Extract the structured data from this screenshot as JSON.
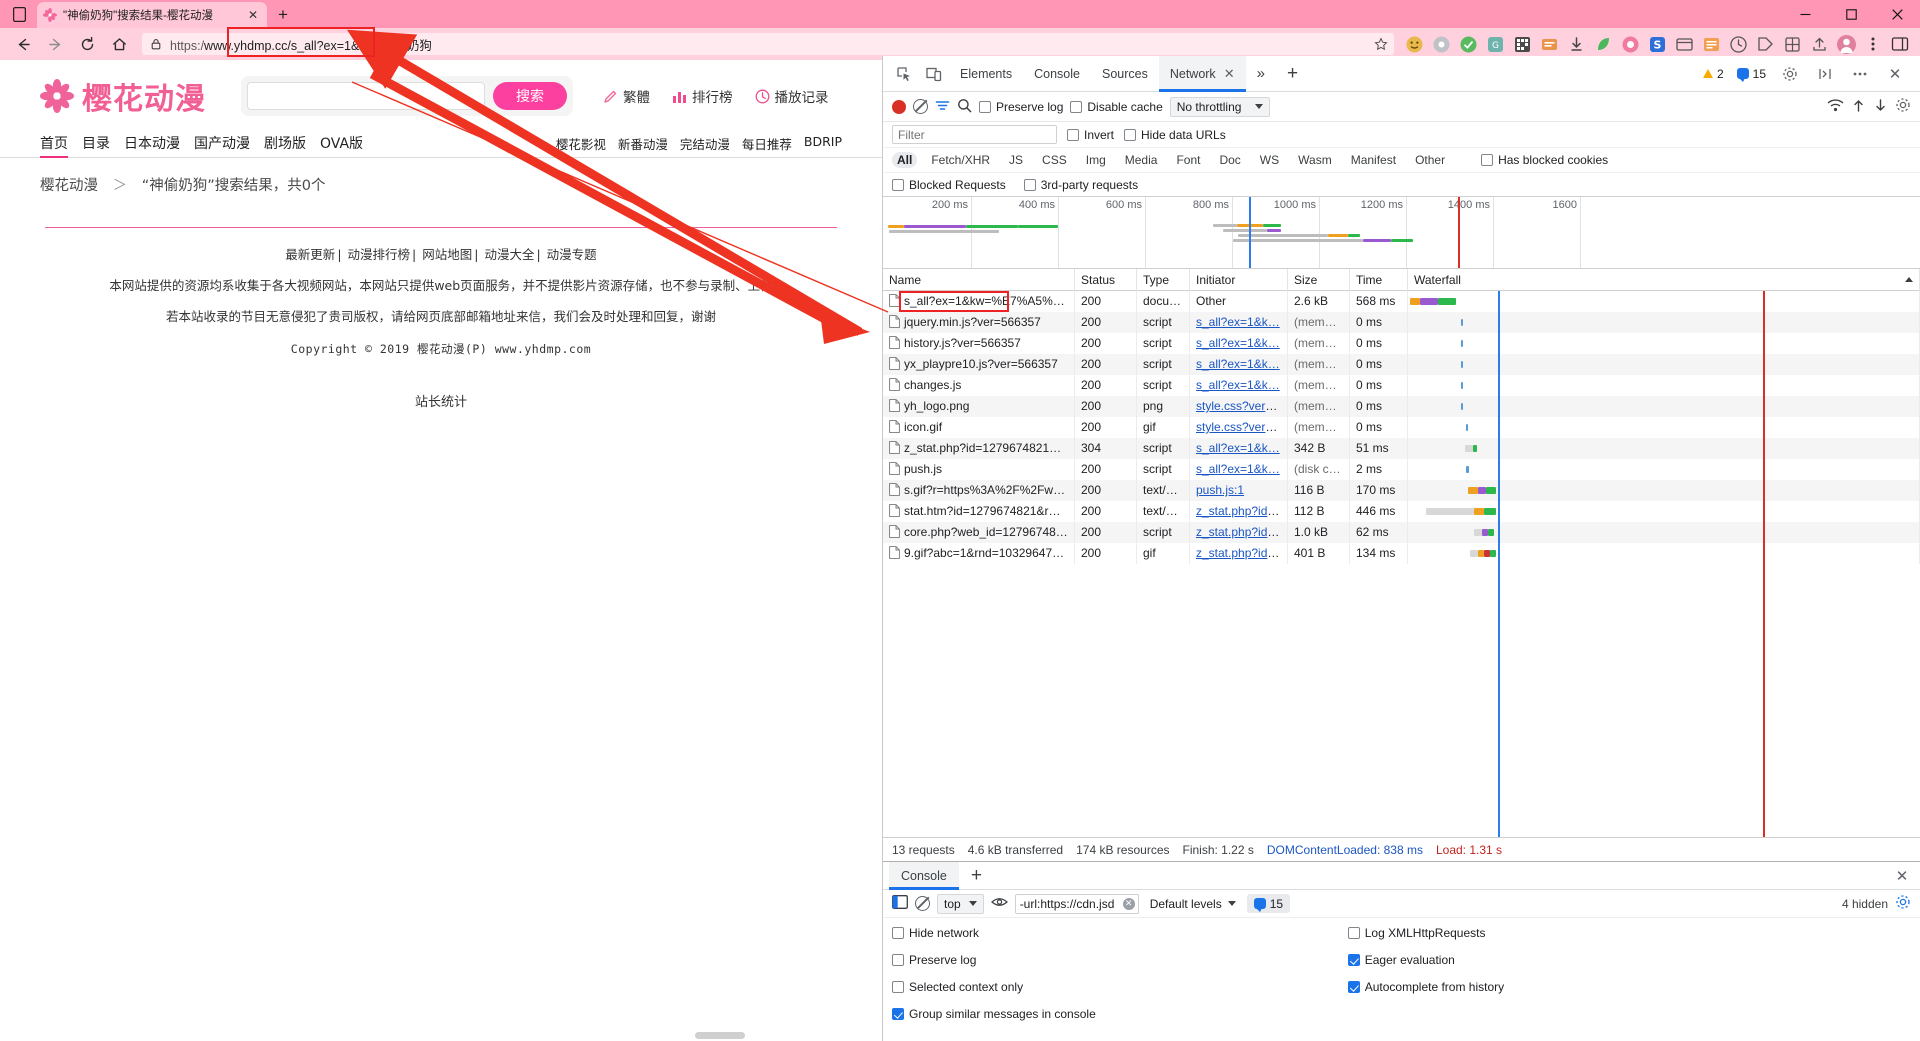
{
  "browser": {
    "tab": {
      "title": "\"神偷奶狗\"搜索结果-樱花动漫",
      "close_label": "✕"
    },
    "new_tab_label": "+",
    "window_controls": {
      "minimize": "—",
      "maximize": "□",
      "close": "✕"
    },
    "nav": {
      "back": "←",
      "forward": "→",
      "reload": "⟳",
      "home": "⌂"
    },
    "omnibox": {
      "scheme": "https:/",
      "url_highlight": "www.yhdmp.cc/s_all?ex=1&k",
      "url_rest": "w=神偷奶狗",
      "full_url": "https://www.yhdmp.cc/s_all?ex=1&kw=神偷奶狗"
    },
    "extensions": [
      "ext-1",
      "ext-2",
      "ext-3",
      "ext-4",
      "ext-5",
      "ext-6",
      "ext-7",
      "ext-8",
      "ext-9",
      "ext-s",
      "ext-10",
      "ext-11",
      "ext-12",
      "ext-13",
      "ext-14",
      "ext-15",
      "ext-avatar",
      "ext-more"
    ]
  },
  "site": {
    "logo_text": "樱花动漫",
    "search": {
      "value": "",
      "placeholder": "",
      "button_label": "搜索"
    },
    "header_links": [
      {
        "label": "繁體",
        "icon": "pen-icon"
      },
      {
        "label": "排行榜",
        "icon": "bars-icon"
      },
      {
        "label": "播放记录",
        "icon": "clock-icon"
      }
    ],
    "nav_left": [
      "首页",
      "目录",
      "日本动漫",
      "国产动漫",
      "剧场版",
      "OVA版"
    ],
    "nav_right": [
      "樱花影视",
      "新番动漫",
      "完结动漫",
      "每日推荐",
      "BDRIP"
    ],
    "breadcrumb": {
      "root": "樱花动漫",
      "sep": "＞",
      "current": "“神偷奶狗”搜索结果，共0个"
    },
    "footer": {
      "links": [
        "最新更新",
        "动漫排行榜",
        "网站地图",
        "动漫大全",
        "动漫专题"
      ],
      "line1": "本网站提供的资源均系收集于各大视频网站，本网站只提供web页面服务，并不提供影片资源存储，也不参与录制、上传",
      "line2": "若本站收录的节目无意侵犯了贵司版权，请给网页底部邮箱地址来信，我们会及时处理和回复，谢谢",
      "copyright": "Copyright © 2019 樱花动漫(P) www.yhdmp.com",
      "stat": "站长统计"
    }
  },
  "devtools": {
    "tabs": [
      "Elements",
      "Console",
      "Sources",
      "Network"
    ],
    "selected_tab": "Network",
    "tab_close_label": "✕",
    "more_tabs_label": "»",
    "add_tab_label": "+",
    "warning_count": "2",
    "message_count": "15",
    "panel_close_label": "✕",
    "toolbar": {
      "record_title": "record",
      "clear_title": "clear",
      "filter_title": "filter",
      "search_title": "search",
      "preserve_log": "Preserve log",
      "disable_cache": "Disable cache",
      "throttling": "No throttling",
      "import_title": "import-har",
      "export_title": "export-har",
      "settings_title": "settings"
    },
    "filter": {
      "placeholder": "Filter",
      "value": "",
      "invert": "Invert",
      "hide_data_urls": "Hide data URLs"
    },
    "types": [
      "All",
      "Fetch/XHR",
      "JS",
      "CSS",
      "Img",
      "Media",
      "Font",
      "Doc",
      "WS",
      "Wasm",
      "Manifest",
      "Other"
    ],
    "selected_type": "All",
    "has_blocked_cookies": "Has blocked cookies",
    "blocked_requests": "Blocked Requests",
    "third_party": "3rd-party requests",
    "overview_ticks": [
      "200 ms",
      "400 ms",
      "600 ms",
      "800 ms",
      "1000 ms",
      "1200 ms",
      "1400 ms",
      "1600 "
    ],
    "columns": [
      "Name",
      "Status",
      "Type",
      "Initiator",
      "Size",
      "Time",
      "Waterfall"
    ],
    "requests": [
      {
        "name": "s_all?ex=1&kw=%E7%A5%9…",
        "status": "200",
        "type": "docum…",
        "initiator": "Other",
        "initiator_link": false,
        "size": "2.6 kB",
        "time": "568 ms"
      },
      {
        "name": "jquery.min.js?ver=566357",
        "status": "200",
        "type": "script",
        "initiator": "s_all?ex=1&k…",
        "initiator_link": true,
        "size": "(memo…",
        "time": "0 ms"
      },
      {
        "name": "history.js?ver=566357",
        "status": "200",
        "type": "script",
        "initiator": "s_all?ex=1&k…",
        "initiator_link": true,
        "size": "(memo…",
        "time": "0 ms"
      },
      {
        "name": "yx_playpre10.js?ver=566357",
        "status": "200",
        "type": "script",
        "initiator": "s_all?ex=1&k…",
        "initiator_link": true,
        "size": "(memo…",
        "time": "0 ms"
      },
      {
        "name": "changes.js",
        "status": "200",
        "type": "script",
        "initiator": "s_all?ex=1&k…",
        "initiator_link": true,
        "size": "(memo…",
        "time": "0 ms"
      },
      {
        "name": "yh_logo.png",
        "status": "200",
        "type": "png",
        "initiator": "style.css?ver=…",
        "initiator_link": true,
        "size": "(memo…",
        "time": "0 ms"
      },
      {
        "name": "icon.gif",
        "status": "200",
        "type": "gif",
        "initiator": "style.css?ver=…",
        "initiator_link": true,
        "size": "(memo…",
        "time": "0 ms"
      },
      {
        "name": "z_stat.php?id=1279674821&…",
        "status": "304",
        "type": "script",
        "initiator": "s_all?ex=1&k…",
        "initiator_link": true,
        "size": "342 B",
        "time": "51 ms"
      },
      {
        "name": "push.js",
        "status": "200",
        "type": "script",
        "initiator": "s_all?ex=1&k…",
        "initiator_link": true,
        "size": "(disk c…",
        "time": "2 ms"
      },
      {
        "name": "s.gif?r=https%3A%2F%2Fww…",
        "status": "200",
        "type": "text/pl…",
        "initiator": "push.js:1",
        "initiator_link": true,
        "size": "116 B",
        "time": "170 ms"
      },
      {
        "name": "stat.htm?id=1279674821&r…",
        "status": "200",
        "type": "text/ht…",
        "initiator": "z_stat.php?id=…",
        "initiator_link": true,
        "size": "112 B",
        "time": "446 ms"
      },
      {
        "name": "core.php?web_id=12796748…",
        "status": "200",
        "type": "script",
        "initiator": "z_stat.php?id=…",
        "initiator_link": true,
        "size": "1.0 kB",
        "time": "62 ms"
      },
      {
        "name": "9.gif?abc=1&rnd=10329647…",
        "status": "200",
        "type": "gif",
        "initiator": "z_stat.php?id=…",
        "initiator_link": true,
        "size": "401 B",
        "time": "134 ms"
      }
    ],
    "summary": {
      "requests": "13 requests",
      "transferred": "4.6 kB transferred",
      "resources": "174 kB resources",
      "finish": "Finish: 1.22 s",
      "dcl": "DOMContentLoaded: 838 ms",
      "load": "Load: 1.31 s"
    },
    "console": {
      "tab_label": "Console",
      "add_tab_label": "+",
      "close_label": "✕",
      "context": "top",
      "filter_value": "-url:https://cdn.jsd",
      "levels": "Default levels",
      "message_count": "15",
      "hidden": "4 hidden",
      "options_left": [
        {
          "label": "Hide network",
          "checked": false
        },
        {
          "label": "Preserve log",
          "checked": false
        },
        {
          "label": "Selected context only",
          "checked": false
        },
        {
          "label": "Group similar messages in console",
          "checked": true
        }
      ],
      "options_right": [
        {
          "label": "Log XMLHttpRequests",
          "checked": false
        },
        {
          "label": "Eager evaluation",
          "checked": true
        },
        {
          "label": "Autocomplete from history",
          "checked": true
        }
      ]
    }
  },
  "annotations": {
    "arrow_color": "#ee3322",
    "boxes": [
      "url-box",
      "request-name-box"
    ]
  }
}
